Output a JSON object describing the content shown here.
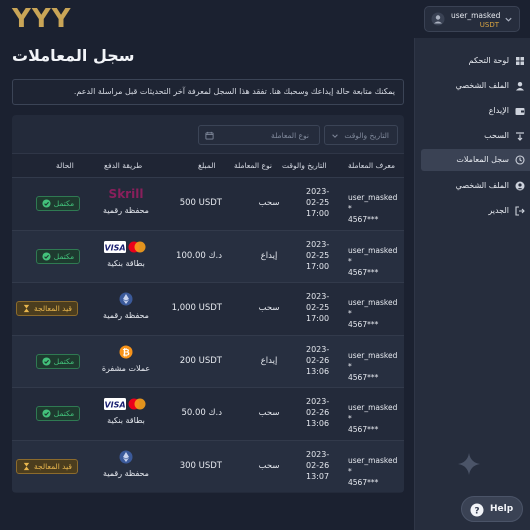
{
  "header": {
    "logo_text": "YYY",
    "user": {
      "name": "user_masked",
      "currency": "USDT"
    }
  },
  "main": {
    "title": "سجل المعاملات",
    "info_text": "يمكنك متابعة حالة إيداعك وسحبك هنا. تفقد هذا السجل لمعرفة آخر التحديثات قبل مراسلة الدعم.",
    "filters": {
      "date_placeholder": "التاريخ والوقت",
      "type_placeholder": "نوع المعاملة"
    },
    "columns": {
      "id": "معرف المعاملة",
      "date": "التاريخ والوقت",
      "type": "نوع المعاملة",
      "amount": "المبلغ",
      "method": "طريقة الدفع",
      "status": "الحالة"
    },
    "rows": [
      {
        "id_line1": "user_masked *",
        "id_line2": "4567***",
        "date_line1": "2023-",
        "date_line2": "02-25",
        "date_line3": "17:00",
        "type": "سحب",
        "amount": "500 USDT",
        "method_icon": "skrill-logo",
        "method_brand": "Skrill",
        "method": "محفظة رقمية",
        "status": "مكتمل",
        "status_kind": "done"
      },
      {
        "id_line1": "user_masked *",
        "id_line2": "4567***",
        "date_line1": "2023-",
        "date_line2": "02-25",
        "date_line3": "17:00",
        "type": "إيداع",
        "amount": "100.00 د.ك",
        "method_icon": "visa-mastercard-logos",
        "method_brand": "VISA",
        "method": "بطاقة بنكية",
        "status": "مكتمل",
        "status_kind": "done"
      },
      {
        "id_line1": "user_masked *",
        "id_line2": "4567***",
        "date_line1": "2023-",
        "date_line2": "02-25",
        "date_line3": "17:00",
        "type": "سحب",
        "amount": "1,000 USDT",
        "method_icon": "ethereum-icon",
        "method_brand": "",
        "method": "محفظة رقمية",
        "status": "قيد المعالجة",
        "status_kind": "pending"
      },
      {
        "id_line1": "user_masked *",
        "id_line2": "4567***",
        "date_line1": "2023-",
        "date_line2": "02-26",
        "date_line3": "13:06",
        "type": "إيداع",
        "amount": "200 USDT",
        "method_icon": "bitcoin-icon",
        "method_brand": "",
        "method": "عملات مشفرة",
        "status": "مكتمل",
        "status_kind": "done"
      },
      {
        "id_line1": "user_masked *",
        "id_line2": "4567***",
        "date_line1": "2023-",
        "date_line2": "02-26",
        "date_line3": "13:06",
        "type": "سحب",
        "amount": "50.00 د.ك",
        "method_icon": "visa-mastercard-logos",
        "method_brand": "VISA",
        "method": "بطاقة بنكية",
        "status": "مكتمل",
        "status_kind": "done"
      },
      {
        "id_line1": "user_masked *",
        "id_line2": "4567***",
        "date_line1": "2023-",
        "date_line2": "02-26",
        "date_line3": "13:07",
        "type": "سحب",
        "amount": "300 USDT",
        "method_icon": "ethereum-icon",
        "method_brand": "",
        "method": "محفظة رقمية",
        "status": "قيد المعالجة",
        "status_kind": "pending"
      }
    ]
  },
  "sidebar": {
    "items": [
      {
        "label": "لوحة التحكم",
        "icon": "dashboard-icon"
      },
      {
        "label": "الملف الشخصي",
        "icon": "user-icon"
      },
      {
        "label": "الإيداع",
        "icon": "wallet-icon"
      },
      {
        "label": "السحب",
        "icon": "withdraw-icon"
      },
      {
        "label": "سجل المعاملات",
        "icon": "history-icon",
        "active": true
      },
      {
        "label": "الملف الشخصي",
        "icon": "profile-icon"
      },
      {
        "label": "الجدير",
        "icon": "logout-icon"
      }
    ],
    "help_label": "Help"
  },
  "colors": {
    "background": "#1b2130",
    "sidebar": "#262d3d",
    "accent_gold": "#c9a557",
    "success": "#43c27b",
    "pending": "#e8b64e"
  }
}
